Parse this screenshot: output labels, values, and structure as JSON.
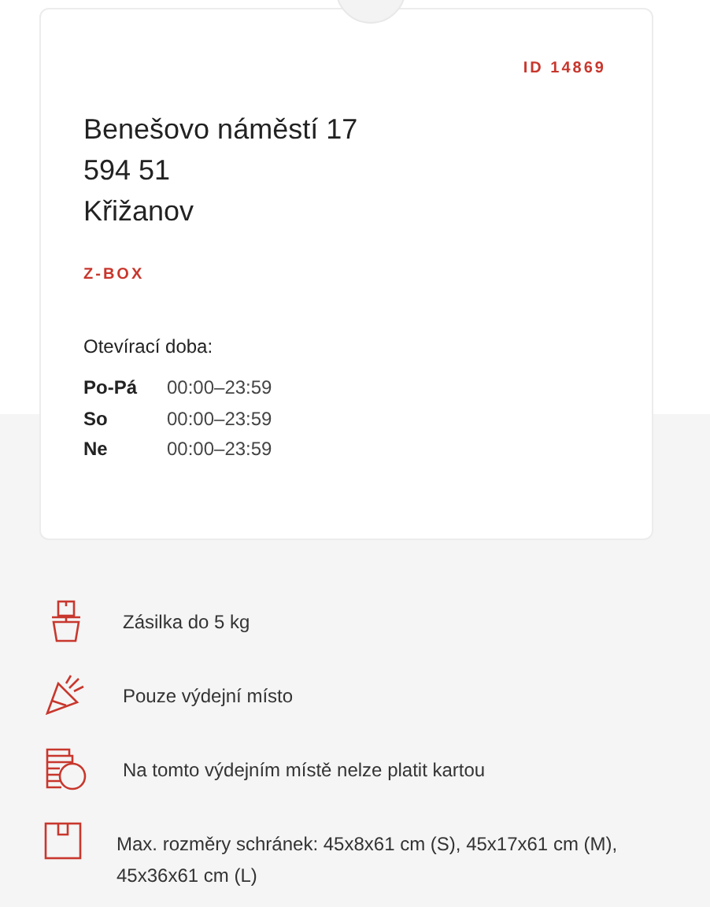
{
  "card": {
    "id": "ID 14869",
    "address": [
      "Benešovo náměstí 17",
      "594 51",
      "Křižanov"
    ],
    "type": "Z-BOX",
    "hours_title": "Otevírací doba:",
    "hours": [
      {
        "days": "Po-Pá",
        "time": "00:00–23:59"
      },
      {
        "days": "So",
        "time": "00:00–23:59"
      },
      {
        "days": "Ne",
        "time": "00:00–23:59"
      }
    ]
  },
  "features": [
    {
      "kind": "weight",
      "text": "Zásilka do 5 kg"
    },
    {
      "kind": "pickup",
      "text": "Pouze výdejní místo"
    },
    {
      "kind": "cash",
      "text": "Na tomto výdejním místě nelze platit kartou"
    },
    {
      "kind": "size",
      "text": "Max. rozměry schránek: 45x8x61 cm (S), 45x17x61 cm (M), 45x36x61 cm (L)"
    }
  ]
}
